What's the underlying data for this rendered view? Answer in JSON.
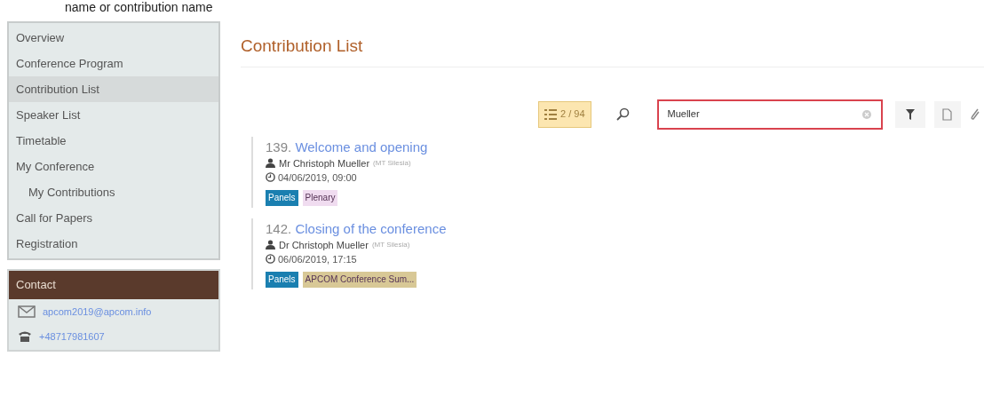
{
  "caption": "name or contribution name",
  "sidebar": {
    "items": [
      {
        "label": "Overview",
        "selected": false
      },
      {
        "label": "Conference Program",
        "selected": false
      },
      {
        "label": "Contribution List",
        "selected": true
      },
      {
        "label": "Speaker List",
        "selected": false
      },
      {
        "label": "Timetable",
        "selected": false
      },
      {
        "label": "My Conference",
        "selected": false,
        "children": [
          {
            "label": "My Contributions",
            "selected": false
          }
        ]
      },
      {
        "label": "Call for Papers",
        "selected": false
      },
      {
        "label": "Registration",
        "selected": false
      }
    ]
  },
  "contact": {
    "title": "Contact",
    "email": "apcom2019@apcom.info",
    "phone": "+48717981607"
  },
  "page_title": "Contribution List",
  "toolbar": {
    "count": "2 / 94",
    "search_value": "Mueller"
  },
  "contributions": [
    {
      "number": "139.",
      "title": "Welcome and opening",
      "speaker": "Mr Christoph Mueller",
      "affiliation": "(MT Silesia)",
      "datetime": "04/06/2019, 09:00",
      "tags": [
        {
          "label": "Panels",
          "color": "#1a7fb0"
        },
        {
          "label": "Plenary",
          "color": "#f0dcf0"
        }
      ]
    },
    {
      "number": "142.",
      "title": "Closing of the conference",
      "speaker": "Dr Christoph Mueller",
      "affiliation": "(MT Silesia)",
      "datetime": "06/06/2019, 17:15",
      "tags": [
        {
          "label": "Panels",
          "color": "#1a7fb0"
        },
        {
          "label": "APCOM Conference Sum...",
          "color": "#d8c896"
        }
      ]
    }
  ]
}
